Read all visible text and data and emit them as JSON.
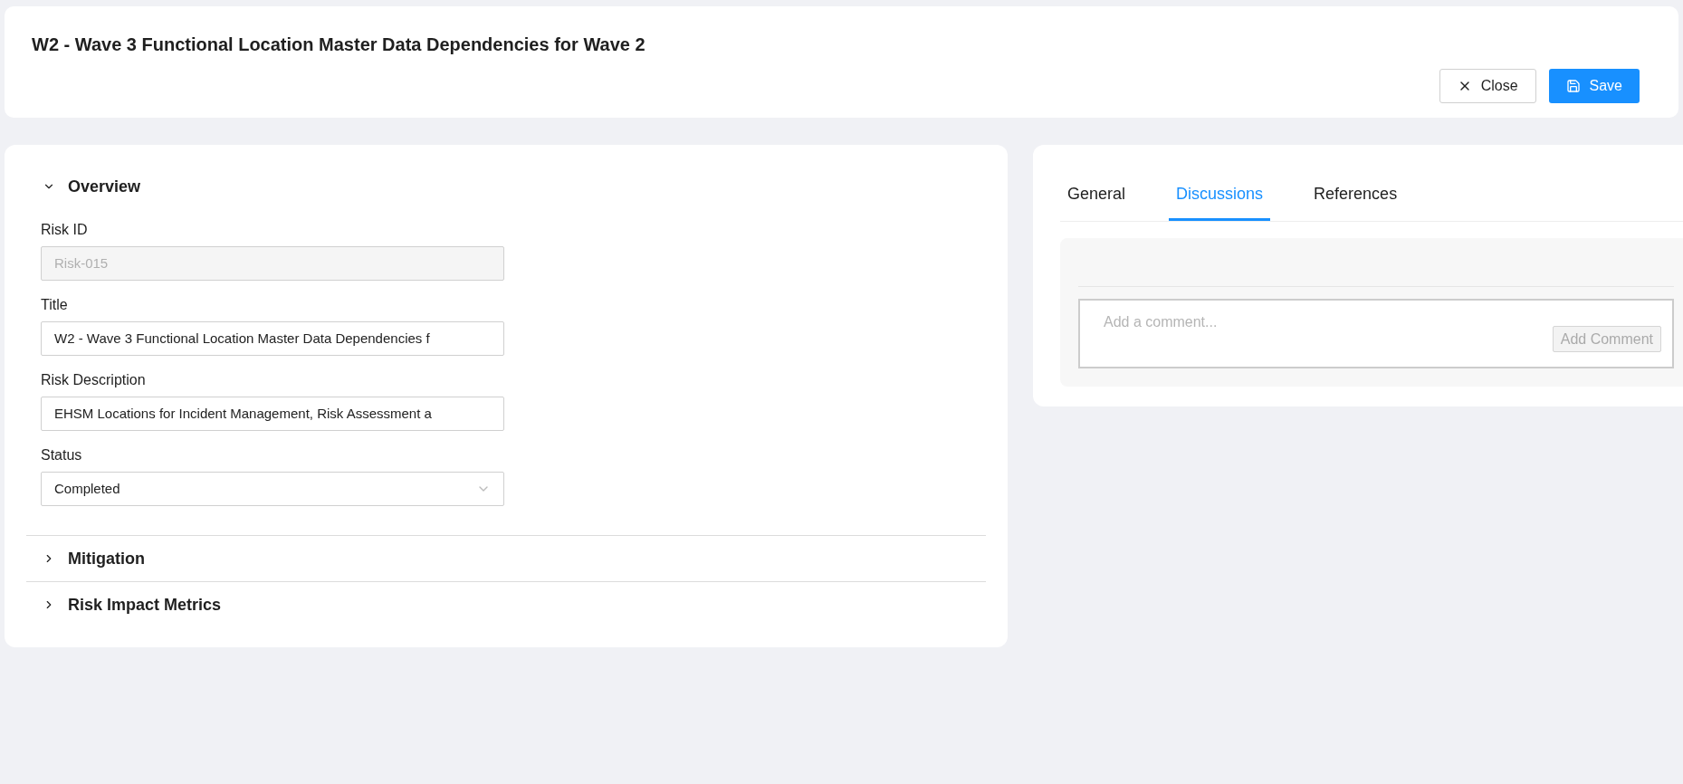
{
  "header": {
    "title": "W2 - Wave 3 Functional Location Master Data Dependencies for Wave 2",
    "buttons": [
      {
        "kind": "secondary",
        "label": "Close"
      },
      {
        "kind": "primary",
        "label": "Save"
      }
    ]
  },
  "sections": [
    {
      "title": "Overview",
      "expanded": true,
      "fields": [
        {
          "kind": "text",
          "label": "Risk ID",
          "value": "Risk-015",
          "disabled": true
        },
        {
          "kind": "text",
          "label": "Title",
          "value": "W2 - Wave 3 Functional Location Master Data Dependencies f",
          "disabled": false
        },
        {
          "kind": "text",
          "label": "Risk Description",
          "value": "EHSM Locations for Incident Management, Risk Assessment a",
          "disabled": false
        },
        {
          "kind": "select",
          "label": "Status",
          "value": "Completed",
          "disabled": false
        }
      ]
    },
    {
      "title": "Mitigation",
      "expanded": false
    },
    {
      "title": "Risk Impact Metrics",
      "expanded": false
    }
  ],
  "tabs": [
    {
      "label": "General",
      "selected": false
    },
    {
      "label": "Discussions",
      "selected": true
    },
    {
      "label": "References",
      "selected": false
    }
  ],
  "comment": {
    "placeholder": "Add a comment...",
    "button": "Add Comment",
    "button_disabled": true
  }
}
